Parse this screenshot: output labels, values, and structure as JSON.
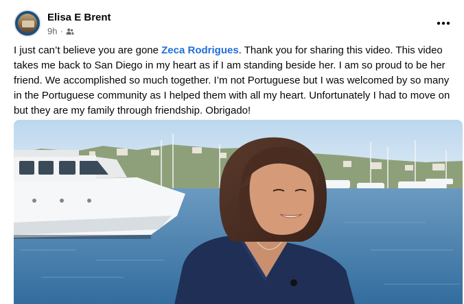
{
  "post": {
    "author": "Elisa E Brent",
    "time": "9h",
    "separator": "·",
    "audience_icon": "friends-icon",
    "more_icon": "more-options-icon",
    "text_before": "I just can’t believe you are gone ",
    "mention": "Zeca Rodrigues",
    "text_after": ". Thank you for sharing this video. This video takes me back to San Diego in my heart as if I am standing beside her. I am so proud to be her friend. We accomplished so much together. I’m not Portuguese but I was welcomed by so many in the Portuguese community as I helped them with all my heart. Unfortunately I had to move on but they are my family through friendship. Obrigado!"
  },
  "colors": {
    "mention": "#216fdb",
    "meta": "#65676b",
    "text": "#050505",
    "water": "#4c86b4",
    "sky": "#cfe3f2",
    "shirt": "#1f2f55",
    "hair": "#4a2c20"
  }
}
